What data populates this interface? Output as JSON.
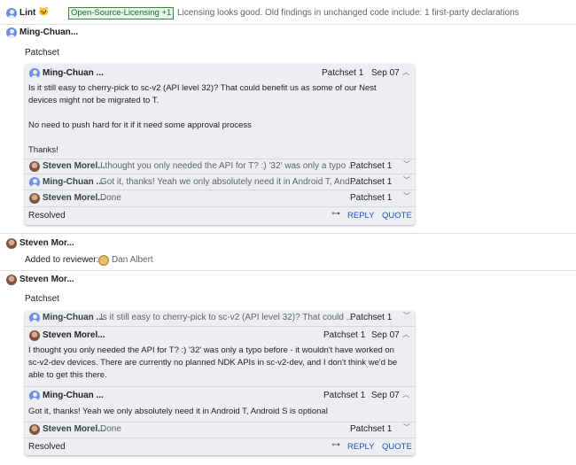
{
  "lint": {
    "author": "Lint",
    "emoji": "🐱",
    "badge": "Open-Source-Licensing +1",
    "message": "Licensing looks good. Old findings in unchanged code include: 1 first-party declarations"
  },
  "comment1": {
    "author": "Ming-Chuan...",
    "patchset_label": "Patchset",
    "thread": {
      "first": {
        "author": "Ming-Chuan ...",
        "patchset": "Patchset 1",
        "date": "Sep 07",
        "line1": "Is it still easy to cherry-pick to sc-v2 (API level 32)? That could benefit us as some of our Nest",
        "line2": "devices might not be migrated to T.",
        "line3": "No need to push hard for it if it need some approval process",
        "line4": "Thanks!"
      },
      "replies": [
        {
          "author": "Steven Morel...",
          "preview": "I thought you only needed the API for T? :) '32' was only a typo ...",
          "patchset": "Patchset 1"
        },
        {
          "author": "Ming-Chuan ...",
          "preview": "Got it, thanks! Yeah we only absolutely need it in Android T, And...",
          "patchset": "Patchset 1"
        },
        {
          "author": "Steven Morel...",
          "preview": "Done",
          "patchset": "Patchset 1"
        }
      ],
      "status": "Resolved",
      "reply": "REPLY",
      "quote": "QUOTE"
    }
  },
  "comment2": {
    "author": "Steven Mor...",
    "message": "Added to reviewer:",
    "reviewer": "Dan Albert"
  },
  "comment3": {
    "author": "Steven Mor...",
    "patchset_label": "Patchset",
    "thread": {
      "collapsed": {
        "author": "Ming-Chuan ...",
        "preview": "Is it still easy to cherry-pick to sc-v2 (API level 32)? That could ...",
        "patchset": "Patchset 1"
      },
      "expanded": {
        "author": "Steven Morel...",
        "patchset": "Patchset 1",
        "date": "Sep 07",
        "line1": "I thought you only needed the API for T? :) '32' was only a typo before - it wouldn't have worked on",
        "line2": "sc-v2-dev devices. There are currently no planned NDK APIs in sc-v2-dev, and I don't think we'd be",
        "line3": "able to get this there."
      },
      "second": {
        "author": "Ming-Chuan ...",
        "patchset": "Patchset 1",
        "date": "Sep 07",
        "line1": "Got it, thanks! Yeah we only absolutely need it in Android T, Android S is optional"
      },
      "last": {
        "author": "Steven Morel...",
        "preview": "Done",
        "patchset": "Patchset 1"
      },
      "status": "Resolved",
      "reply": "REPLY",
      "quote": "QUOTE"
    }
  }
}
